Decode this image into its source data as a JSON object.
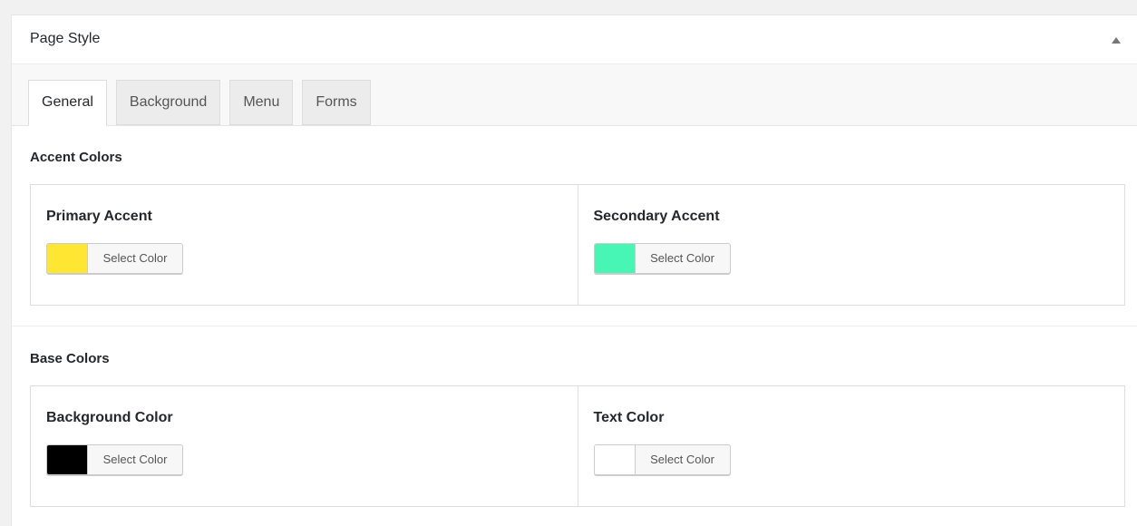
{
  "panel": {
    "title": "Page Style"
  },
  "tabs": [
    {
      "label": "General",
      "active": true
    },
    {
      "label": "Background",
      "active": false
    },
    {
      "label": "Menu",
      "active": false
    },
    {
      "label": "Forms",
      "active": false
    }
  ],
  "accent_colors": {
    "title": "Accent Colors",
    "fields": [
      {
        "label": "Primary Accent",
        "button_label": "Select Color",
        "color": "#ffe633"
      },
      {
        "label": "Secondary Accent",
        "button_label": "Select Color",
        "color": "#47f5b5"
      }
    ]
  },
  "base_colors": {
    "title": "Base Colors",
    "fields": [
      {
        "label": "Background Color",
        "button_label": "Select Color",
        "color": "#000000"
      },
      {
        "label": "Text Color",
        "button_label": "Select Color",
        "color": "#ffffff"
      }
    ]
  },
  "icons": {
    "collapse": "triangle-up-icon"
  }
}
